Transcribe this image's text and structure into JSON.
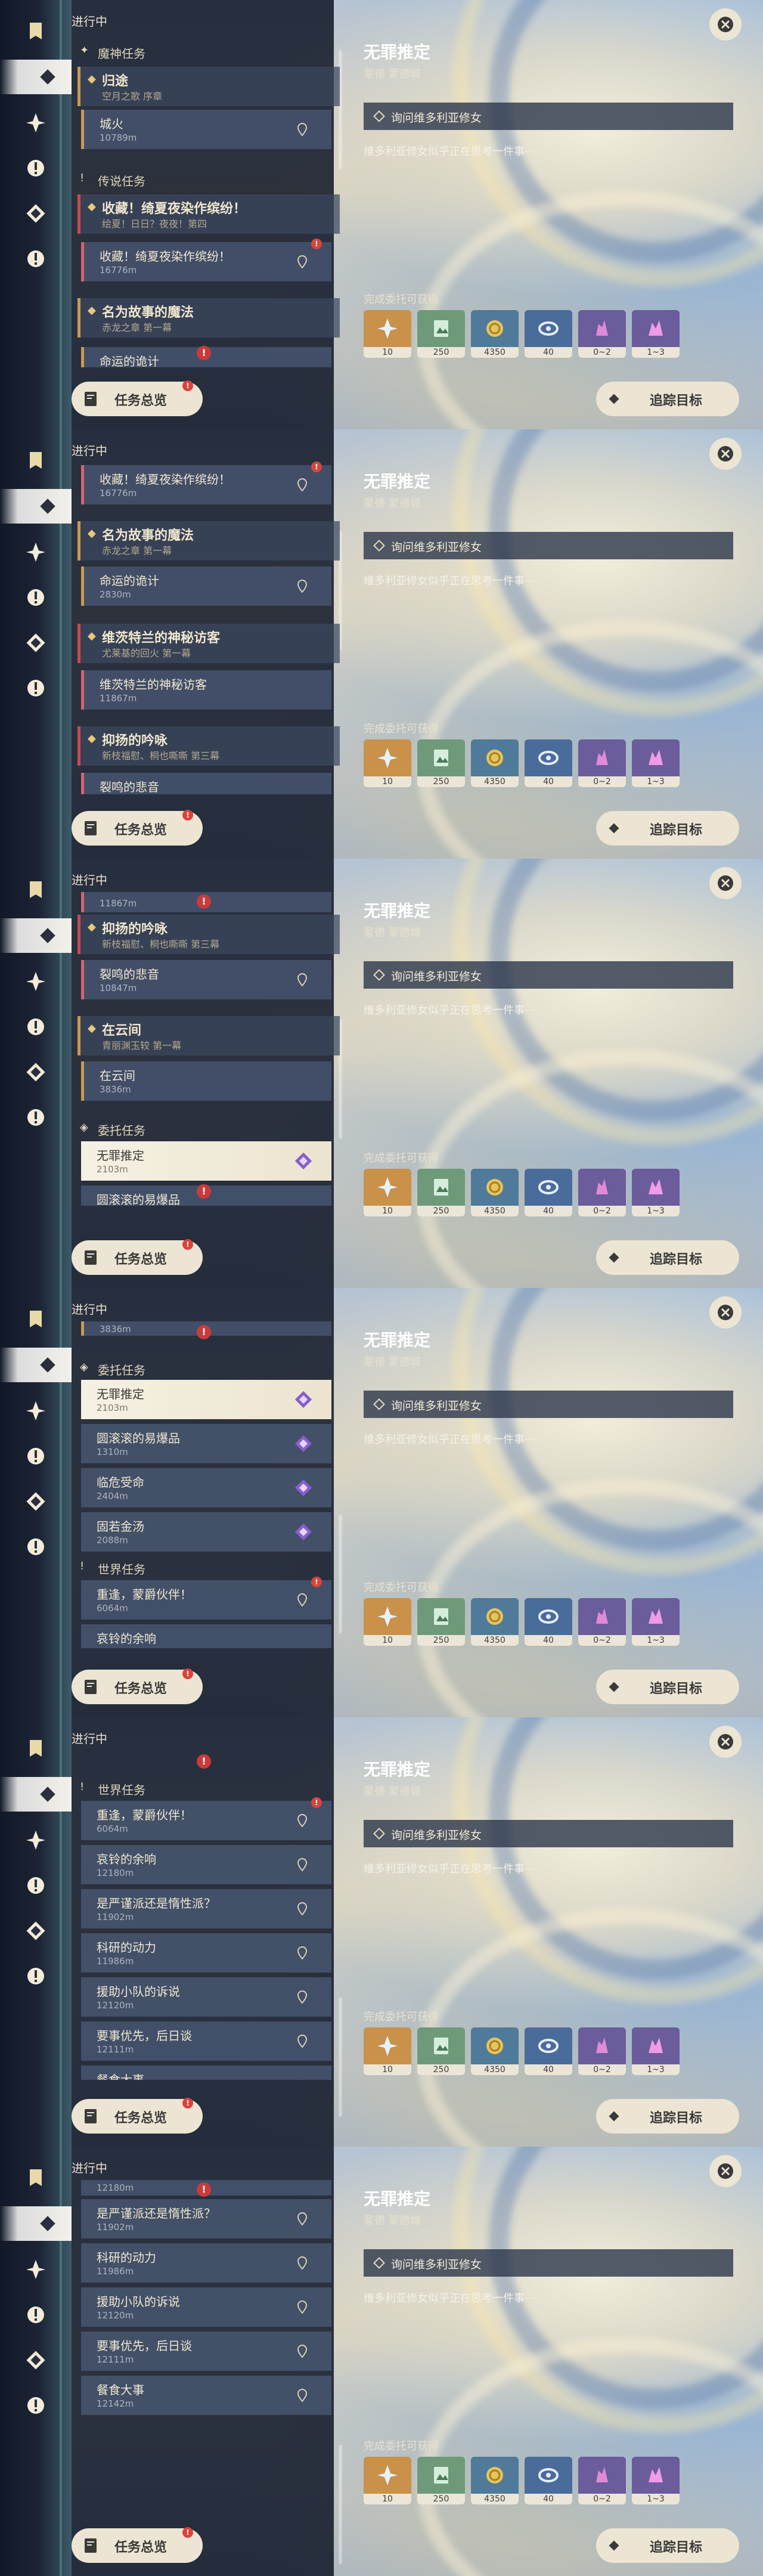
{
  "ui": {
    "in_progress": "进行中",
    "overview_label": "任务总览",
    "overview_badge": "!",
    "track_label": "追踪目标"
  },
  "detail": {
    "title": "无罪推定",
    "location": "蒙德 蒙德城",
    "objective": "询问维多利亚修女",
    "description": "维多利亚修女似乎正在思考一件事···",
    "rewards_label": "完成委托可获得",
    "rewards": [
      {
        "name": "原石",
        "icon": "primogem-icon",
        "count": "10",
        "bg": "#c9914a"
      },
      {
        "name": "冒险阅历",
        "icon": "adventure-exp-icon",
        "count": "250",
        "bg": "#6e9a7a"
      },
      {
        "name": "摩拉",
        "icon": "mora-icon",
        "count": "4350",
        "bg": "#4f7a9a"
      },
      {
        "name": "好感",
        "icon": "companionship-icon",
        "count": "40",
        "bg": "#4a6c9b"
      },
      {
        "name": "精锻用矿石",
        "icon": "ore-icon",
        "count": "0~2",
        "bg": "#6b5c9b"
      },
      {
        "name": "精锻用良矿",
        "icon": "crystal-icon",
        "count": "1~3",
        "bg": "#6b5c9b"
      }
    ]
  },
  "quests": {
    "archon_header": "魔神任务",
    "q_guizhu_title": "归途",
    "q_guizhu_sub": "空月之歌 序章",
    "q_guizhu_step": "城火",
    "q_guizhu_dist": "10789m",
    "legend_header": "传说任务",
    "q_shouqu_title": "收藏！绮夏夜染作缤纷！",
    "q_shouqu_sub": "绘夏！日日？夜夜！第四",
    "q_shouqu_step": "收藏！绮夏夜染作缤纷！",
    "q_shouqu_dist": "16776m",
    "q_mingwei_title": "名为故事的魔法",
    "q_mingwei_sub": "赤龙之章 第一幕",
    "q_mingwei_step": "命运的诡计",
    "q_mingwei_dist": "2830m",
    "q_weiqi_title": "维茨特兰的神秘访客",
    "q_weiqi_sub": "尤莱基的回火 第一幕",
    "q_weiqi_step": "维茨特兰的神秘访客",
    "q_weiqi_dist": "11867m",
    "q_yiyang_title": "抑扬的吟咏",
    "q_yiyang_sub": "新枝福慰、桐也嘶嘶 第三幕",
    "q_yiyang_step": "裂鸣的悲音",
    "q_yiyang_dist": "10847m",
    "q_zaiyun_title": "在云间",
    "q_zaiyun_sub": "青丽渊玉较 第一幕",
    "q_zaiyun_step": "在云间",
    "q_zaiyun_dist": "3836m",
    "commission_header": "委托任务",
    "c1_title": "无罪推定",
    "c1_dist": "2103m",
    "c2_title": "圆滚滚的易爆品",
    "c2_dist": "1310m",
    "c3_title": "临危受命",
    "c3_dist": "2404m",
    "c4_title": "固若金汤",
    "c4_dist": "2088m",
    "world_header": "世界任务",
    "w1_title": "重逢，蒙爵伙伴！",
    "w1_dist": "6064m",
    "w2_title": "哀铃的余响",
    "w2_dist": "12180m",
    "w3_title": "是严谨派还是惰性派？",
    "w3_dist": "11902m",
    "w4_title": "科研的动力",
    "w4_dist": "11986m",
    "w5_title": "援助小队的诉说",
    "w5_dist": "12120m",
    "w6_title": "要事优先，后日谈",
    "w6_dist": "12111m",
    "w7_title": "餐食大事",
    "w7_dist": "12142m"
  }
}
